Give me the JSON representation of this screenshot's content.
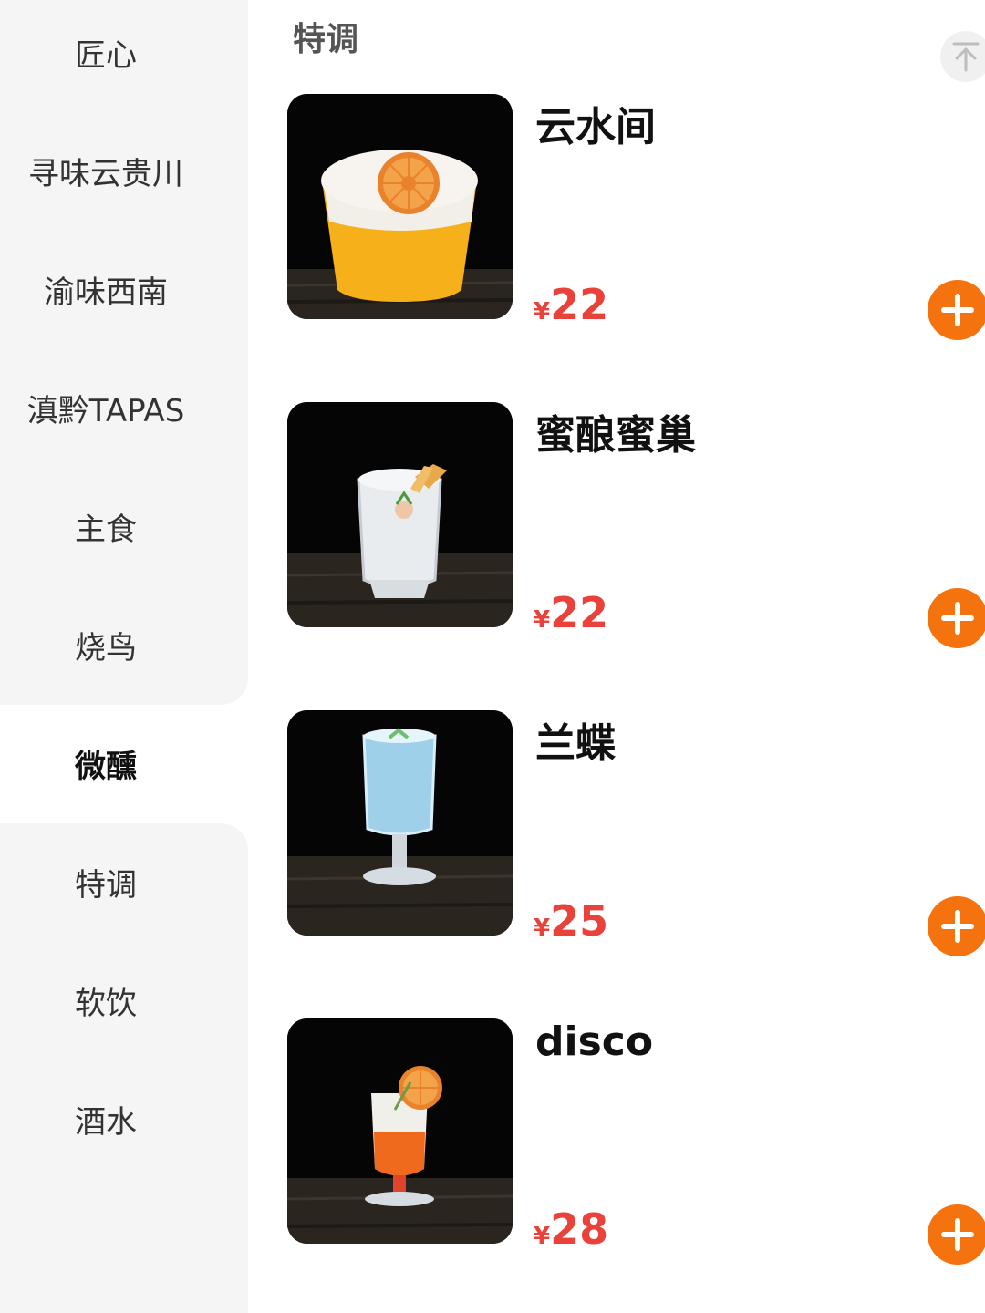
{
  "sidebar": {
    "items": [
      {
        "label": "匠心"
      },
      {
        "label": "寻味云贵川"
      },
      {
        "label": "渝味西南"
      },
      {
        "label": "滇黔TAPAS"
      },
      {
        "label": "主食"
      },
      {
        "label": "烧鸟"
      },
      {
        "label": "微醺",
        "active": true
      },
      {
        "label": "特调"
      },
      {
        "label": "软饮"
      },
      {
        "label": "酒水"
      }
    ]
  },
  "main": {
    "section_title": "特调",
    "back_to_top_icon": "arrow-up-to-top-icon",
    "products": [
      {
        "name": "云水间",
        "currency": "¥",
        "price": "22",
        "image": "orange-cocktail-cup-with-dried-orange-slice"
      },
      {
        "name": "蜜酿蜜巢",
        "currency": "¥",
        "price": "22",
        "image": "clear-crystal-glass-with-honeycomb-garnish"
      },
      {
        "name": "兰蝶",
        "currency": "¥",
        "price": "25",
        "image": "blue-drink-in-stemmed-glass"
      },
      {
        "name": "disco",
        "currency": "¥",
        "price": "28",
        "image": "orange-layered-drink-with-orange-slice"
      }
    ]
  },
  "colors": {
    "sidebar_bg": "#f5f5f5",
    "price": "#e8423a",
    "add_button": "#f5730f"
  }
}
